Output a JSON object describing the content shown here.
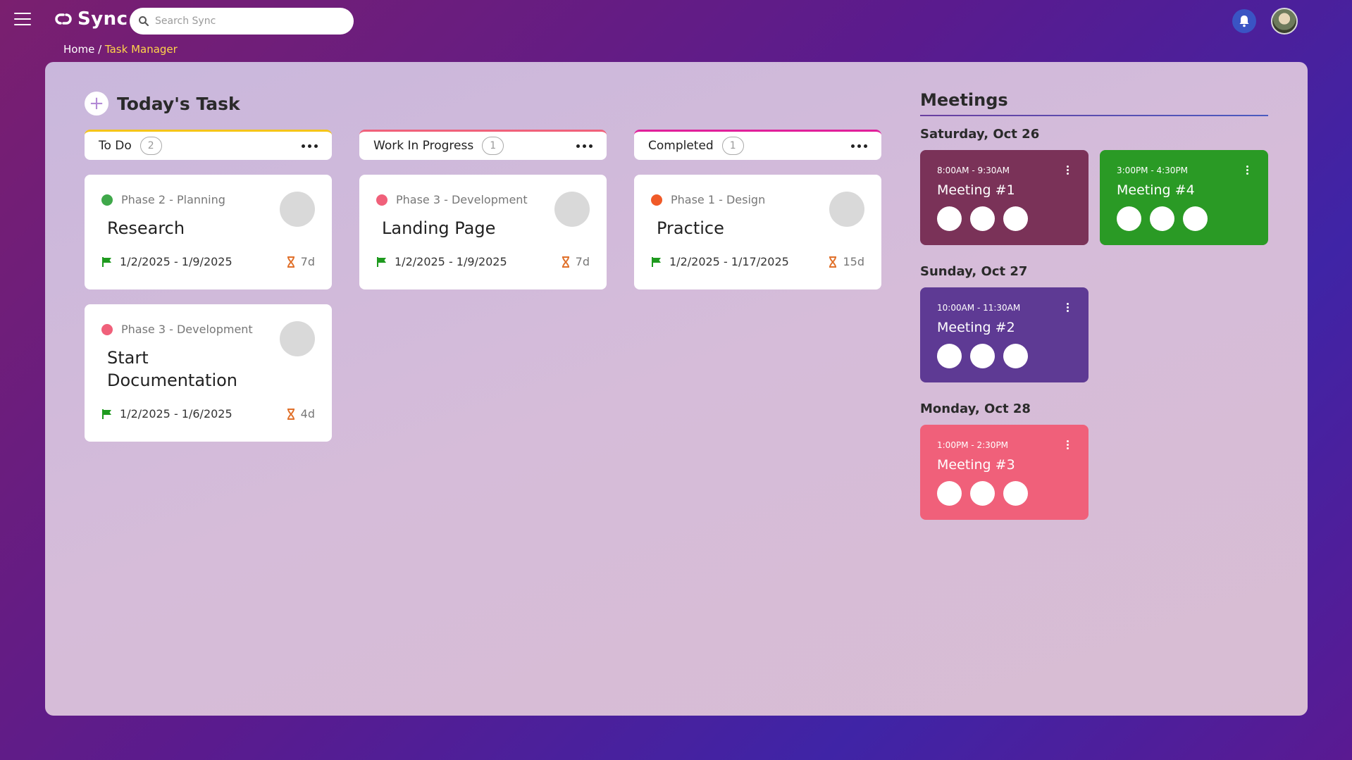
{
  "app": {
    "name": "Sync"
  },
  "search": {
    "placeholder": "Search Sync"
  },
  "breadcrumb": {
    "home": "Home",
    "separator": "/",
    "current": "Task Manager"
  },
  "tasks": {
    "title": "Today's Task",
    "add_label": "+",
    "columns": [
      {
        "name": "To Do",
        "count": "2",
        "accent": "#f5c518"
      },
      {
        "name": "Work In Progress",
        "count": "1",
        "accent": "#f0607a"
      },
      {
        "name": "Completed",
        "count": "1",
        "accent": "#e0209a"
      }
    ],
    "cards": [
      {
        "phase": "Phase 2 - Planning",
        "phase_color": "#3fa84a",
        "title": "Research",
        "dates": "1/2/2025 - 1/9/2025",
        "duration": "7d"
      },
      {
        "phase": "Phase 3 - Development",
        "phase_color": "#f0607a",
        "title": "Start Documentation",
        "dates": "1/2/2025 - 1/6/2025",
        "duration": "4d"
      },
      {
        "phase": "Phase 3 - Development",
        "phase_color": "#f0607a",
        "title": "Landing Page",
        "dates": "1/2/2025 - 1/9/2025",
        "duration": "7d"
      },
      {
        "phase": "Phase 1 - Design",
        "phase_color": "#f05a28",
        "title": "Practice",
        "dates": "1/2/2025 - 1/17/2025",
        "duration": "15d"
      }
    ]
  },
  "meetings": {
    "title": "Meetings",
    "days": [
      {
        "label": "Saturday, Oct 26"
      },
      {
        "label": "Sunday, Oct 27"
      },
      {
        "label": "Monday, Oct 28"
      }
    ],
    "items": [
      {
        "time": "8:00AM - 9:30AM",
        "name": "Meeting #1",
        "color": "#7a3258"
      },
      {
        "time": "3:00PM - 4:30PM",
        "name": "Meeting #4",
        "color": "#2a9a25"
      },
      {
        "time": "10:00AM - 11:30AM",
        "name": "Meeting #2",
        "color": "#5e3a94"
      },
      {
        "time": "1:00PM - 2:30PM",
        "name": "Meeting #3",
        "color": "#f0607a"
      }
    ]
  },
  "colors": {
    "flag": "#1e9a1e",
    "hourglass": "#e0702a",
    "bell": "#3a54c4"
  }
}
